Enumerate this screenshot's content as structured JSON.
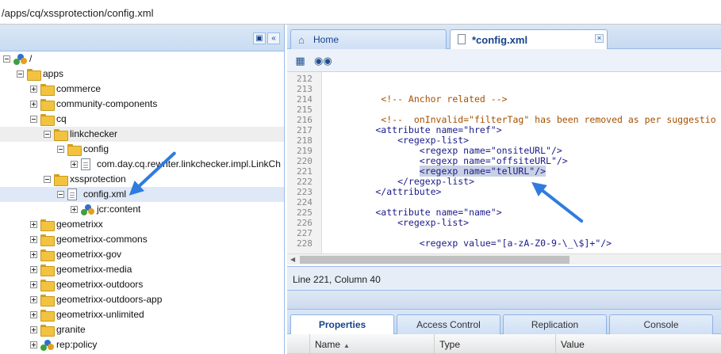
{
  "address": {
    "path": "/apps/cq/xssprotection/config.xml"
  },
  "tree": {
    "nodes": [
      {
        "label": "/",
        "depth": 0,
        "toggle": "minus",
        "icon": "root-node-icon"
      },
      {
        "label": "apps",
        "depth": 1,
        "toggle": "minus",
        "icon": "folder-icon"
      },
      {
        "label": "commerce",
        "depth": 2,
        "toggle": "plus",
        "icon": "folder-icon"
      },
      {
        "label": "community-components",
        "depth": 2,
        "toggle": "plus",
        "icon": "folder-icon"
      },
      {
        "label": "cq",
        "depth": 2,
        "toggle": "minus",
        "icon": "folder-icon"
      },
      {
        "label": "linkchecker",
        "depth": 3,
        "toggle": "minus",
        "icon": "folder-icon"
      },
      {
        "label": "config",
        "depth": 4,
        "toggle": "minus",
        "icon": "folder-icon"
      },
      {
        "label": "com.day.cq.rewriter.linkchecker.impl.LinkCh",
        "depth": 5,
        "toggle": "plus",
        "icon": "file-icon"
      },
      {
        "label": "xssprotection",
        "depth": 3,
        "toggle": "minus",
        "icon": "folder-icon"
      },
      {
        "label": "config.xml",
        "depth": 4,
        "toggle": "minus",
        "icon": "file-icon"
      },
      {
        "label": "jcr:content",
        "depth": 5,
        "toggle": "plus",
        "icon": "node-icon"
      },
      {
        "label": "geometrixx",
        "depth": 2,
        "toggle": "plus",
        "icon": "folder-icon"
      },
      {
        "label": "geometrixx-commons",
        "depth": 2,
        "toggle": "plus",
        "icon": "folder-icon"
      },
      {
        "label": "geometrixx-gov",
        "depth": 2,
        "toggle": "plus",
        "icon": "folder-icon"
      },
      {
        "label": "geometrixx-media",
        "depth": 2,
        "toggle": "plus",
        "icon": "folder-icon"
      },
      {
        "label": "geometrixx-outdoors",
        "depth": 2,
        "toggle": "plus",
        "icon": "folder-icon"
      },
      {
        "label": "geometrixx-outdoors-app",
        "depth": 2,
        "toggle": "plus",
        "icon": "folder-icon"
      },
      {
        "label": "geometrixx-unlimited",
        "depth": 2,
        "toggle": "plus",
        "icon": "folder-icon"
      },
      {
        "label": "granite",
        "depth": 2,
        "toggle": "plus",
        "icon": "folder-icon"
      },
      {
        "label": "rep:policy",
        "depth": 2,
        "toggle": "plus",
        "icon": "node-icon"
      }
    ]
  },
  "tabs": {
    "home": "Home",
    "file": "*config.xml"
  },
  "editor": {
    "lines": [
      {
        "num": "212",
        "text": ""
      },
      {
        "num": "213",
        "text": ""
      },
      {
        "num": "214",
        "text": "         <!-- Anchor related -->"
      },
      {
        "num": "215",
        "text": ""
      },
      {
        "num": "216",
        "text": "         <!--  onInvalid=\"filterTag\" has been removed as per suggestio"
      },
      {
        "num": "217",
        "text": "        <attribute name=\"href\">"
      },
      {
        "num": "218",
        "text": "            <regexp-list>"
      },
      {
        "num": "219",
        "text": "                <regexp name=\"onsiteURL\"/>"
      },
      {
        "num": "220",
        "text": "                <regexp name=\"offsiteURL\"/>"
      },
      {
        "num": "221",
        "text": "                <regexp name=\"telURL\"/>"
      },
      {
        "num": "222",
        "text": "            </regexp-list>"
      },
      {
        "num": "223",
        "text": "        </attribute>"
      },
      {
        "num": "224",
        "text": ""
      },
      {
        "num": "225",
        "text": "        <attribute name=\"name\">"
      },
      {
        "num": "226",
        "text": "            <regexp-list>"
      },
      {
        "num": "227",
        "text": ""
      },
      {
        "num": "228",
        "text": "                <regexp value=\"[a-zA-Z0-9-\\_\\$]+\"/>"
      }
    ]
  },
  "status": {
    "position": "Line 221, Column 40"
  },
  "props_tabs": [
    "Properties",
    "Access Control",
    "Replication",
    "Console"
  ],
  "grid": {
    "columns": [
      "Name",
      "Type",
      "Value"
    ]
  },
  "colors": {
    "accent": "#15428b",
    "arrow": "#2f7be0",
    "panel": "#dae7f6"
  }
}
